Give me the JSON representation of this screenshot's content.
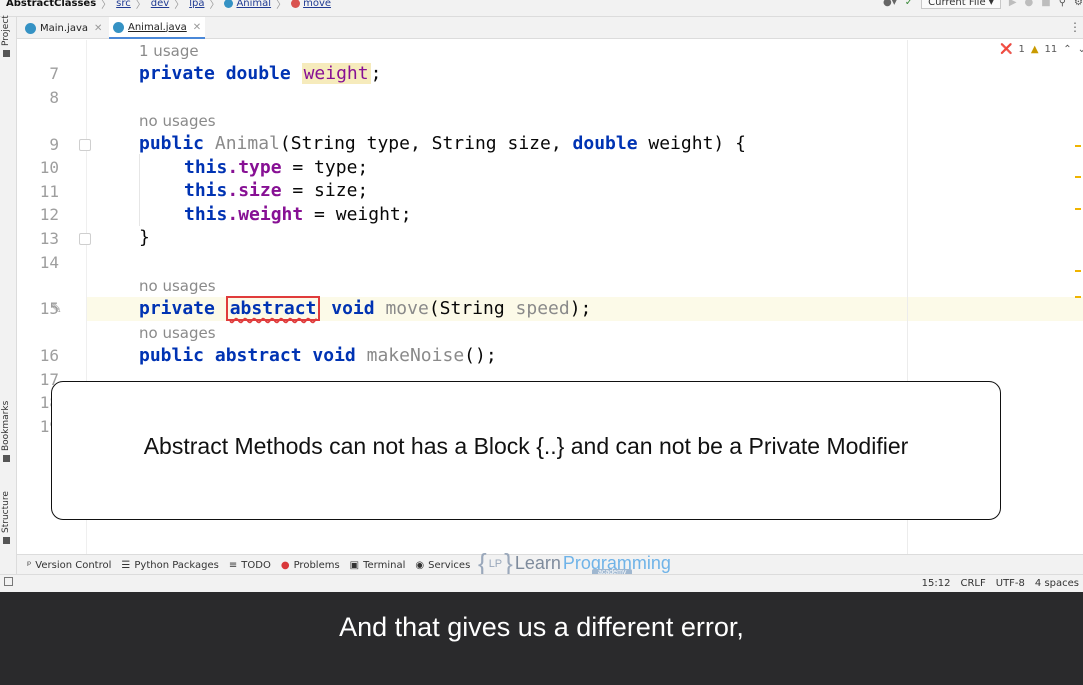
{
  "navbar": {
    "project": "AbstractClasses",
    "crumbs": [
      "src",
      "dev",
      "lpa",
      "Animal",
      "move"
    ],
    "run_config": "Current File"
  },
  "tabs": [
    {
      "label": "Main.java",
      "active": false
    },
    {
      "label": "Animal.java",
      "active": true
    }
  ],
  "side_tools": {
    "project": "Project",
    "bookmarks": "Bookmarks",
    "structure": "Structure"
  },
  "inspections": {
    "errors": "1",
    "warnings": "11"
  },
  "editor": {
    "usage_hints": [
      "1 usage",
      "no usages",
      "no usages",
      "no usages"
    ],
    "line_numbers": [
      "7",
      "8",
      "9",
      "10",
      "11",
      "12",
      "13",
      "14",
      "15",
      "16",
      "17",
      "18",
      "19"
    ],
    "lines": {
      "l7": {
        "kw1": "private",
        "kw2": "double",
        "field": "weight",
        "end": ";"
      },
      "l9": {
        "kw": "public",
        "name": "Animal",
        "params": "(String type, String size, ",
        "kw2": "double",
        "rest": " weight) {"
      },
      "l10": {
        "kw": "this",
        "field": ".type",
        "rest": " = type;"
      },
      "l11": {
        "kw": "this",
        "field": ".size",
        "rest": " = size;"
      },
      "l12": {
        "kw": "this",
        "field": ".weight",
        "rest": " = weight;"
      },
      "l13": {
        "text": "}"
      },
      "l15": {
        "kw1": "private",
        "kw2": "abstract",
        "kw3": "void",
        "name": "move",
        "open": "(String ",
        "param": "speed",
        "close": ");"
      },
      "l16": {
        "kw1": "public",
        "kw2": "abstract",
        "kw3": "void",
        "name": "makeNoise",
        "end": "();"
      }
    }
  },
  "callout": "Abstract Methods can not has a Block {..} and can not be a Private Modifier",
  "bottom_tools": [
    "Version Control",
    "Python Packages",
    "TODO",
    "Problems",
    "Terminal",
    "Services"
  ],
  "logo": {
    "brace_open": "{",
    "up": "LP",
    "brace_close": "}",
    "learn": "Learn",
    "programming": "Programming",
    "academy": "academy"
  },
  "status": {
    "position": "15:12",
    "line_sep": "CRLF",
    "encoding": "UTF-8",
    "indent": "4 spaces"
  },
  "caption": "And that gives us a different error,"
}
